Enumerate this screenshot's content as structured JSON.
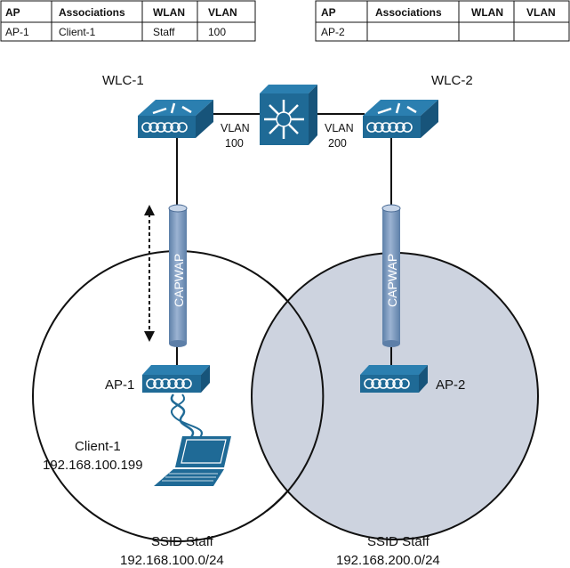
{
  "tables": [
    {
      "headers": [
        "AP",
        "Associations",
        "WLAN",
        "VLAN"
      ],
      "row": [
        "AP-1",
        "Client-1",
        "Staff",
        "100"
      ]
    },
    {
      "headers": [
        "AP",
        "Associations",
        "WLAN",
        "VLAN"
      ],
      "row": [
        "AP-2",
        "",
        "",
        ""
      ]
    }
  ],
  "wlc1": {
    "label": "WLC-1"
  },
  "wlc2": {
    "label": "WLC-2"
  },
  "vlan_left": {
    "line1": "VLAN",
    "line2": "100"
  },
  "vlan_right": {
    "line1": "VLAN",
    "line2": "200"
  },
  "tunnel_left": {
    "label": "CAPWAP"
  },
  "tunnel_right": {
    "label": "CAPWAP"
  },
  "ap1": {
    "label": "AP-1"
  },
  "ap2": {
    "label": "AP-2"
  },
  "client": {
    "name": "Client-1",
    "ip": "192.168.100.199"
  },
  "cell_left": {
    "ssid": "SSID Staff",
    "subnet": "192.168.100.0/24"
  },
  "cell_right": {
    "ssid": "SSID Staff",
    "subnet": "192.168.200.0/24"
  },
  "colors": {
    "device": "#1f6a96",
    "device_top": "#2b7fb0",
    "tunnel": "#7f9cc0",
    "cell_fill": "#cdd3df"
  },
  "icons": [
    "wireless-lan-controller-icon",
    "multilayer-switch-icon",
    "access-point-icon",
    "laptop-icon",
    "capwap-tunnel-icon",
    "roaming-arrow-icon",
    "wireless-signal-icon"
  ]
}
